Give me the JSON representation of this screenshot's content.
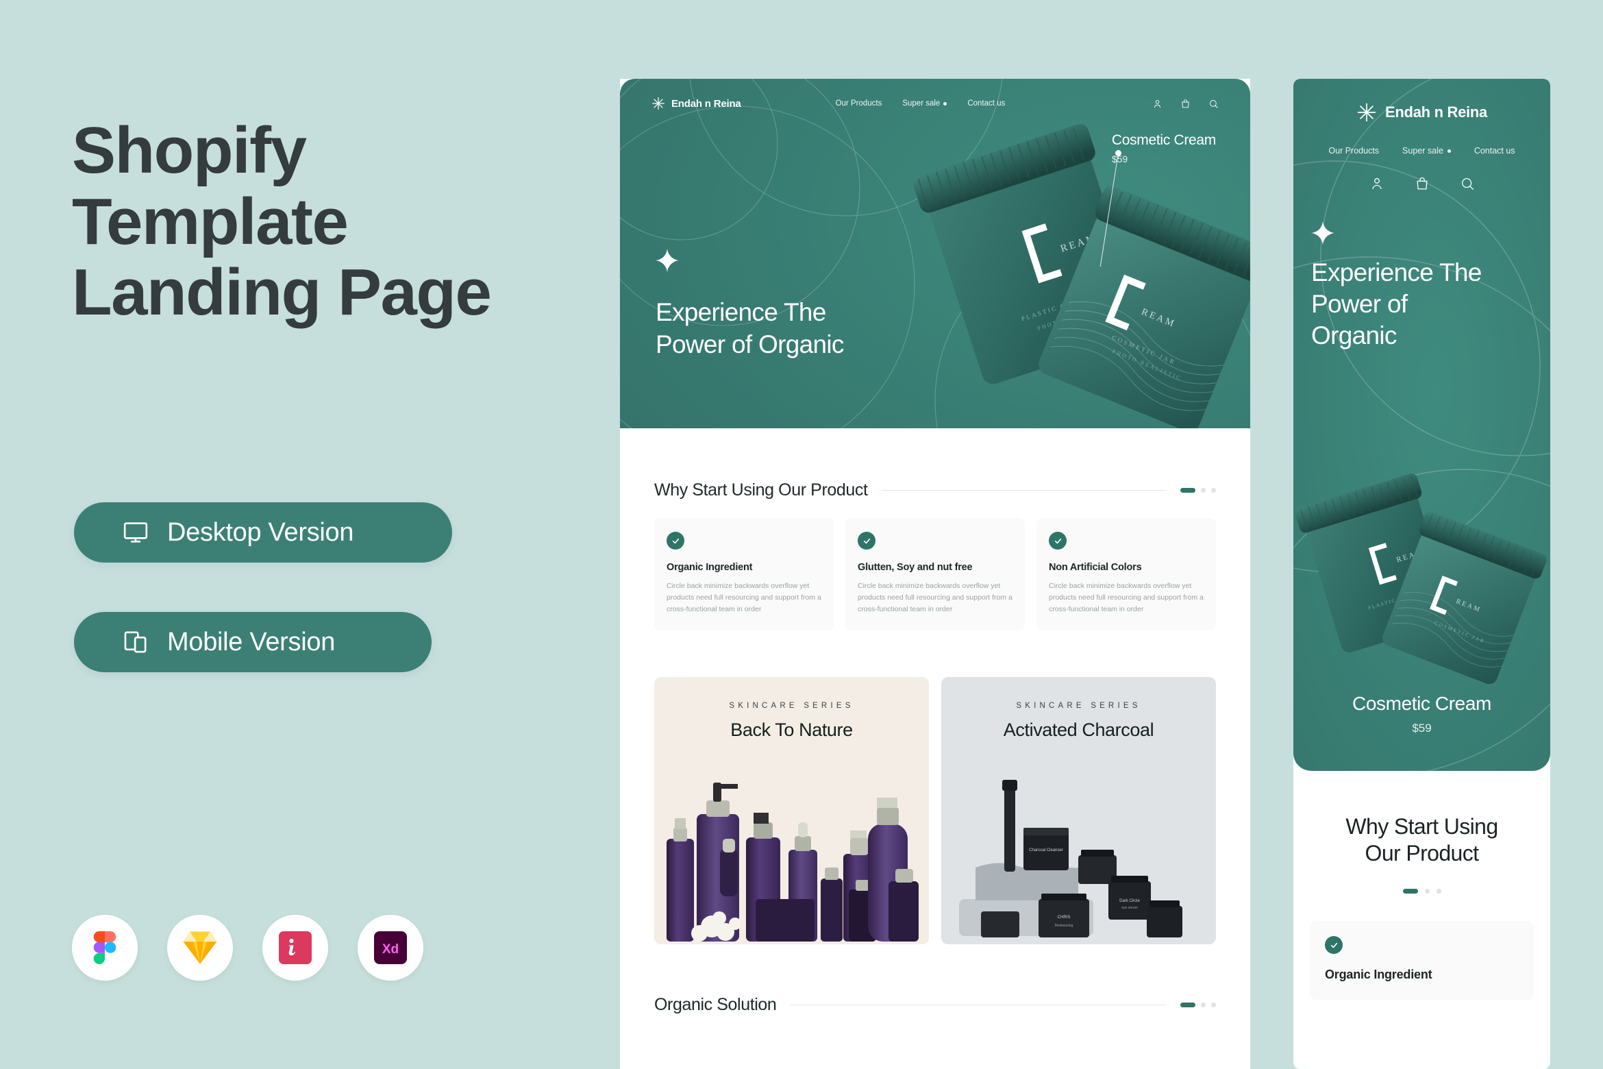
{
  "theme": {
    "page_bg": "#c6dfdc",
    "brand_teal": "#3c8075",
    "hero_teal": "#377a70",
    "heading_dark": "#343c3d",
    "card_bg": "#fafafa",
    "nature_bg": "#f4ede6",
    "charcoal_bg": "#dfe3e6"
  },
  "promo": {
    "line1": "Shopify",
    "line2": "Template",
    "line3": "Landing Page",
    "buttons": [
      {
        "label": "Desktop Version",
        "icon": "monitor-icon"
      },
      {
        "label": "Mobile Version",
        "icon": "devices-icon"
      }
    ],
    "apps": [
      {
        "name": "figma-icon",
        "label": "Figma"
      },
      {
        "name": "sketch-icon",
        "label": "Sketch"
      },
      {
        "name": "invision-icon",
        "label": "InVision"
      },
      {
        "name": "adobe-xd-icon",
        "label": "Adobe XD"
      }
    ]
  },
  "site": {
    "brand": "Endah n Reina",
    "nav": [
      {
        "label": "Our Products",
        "badge": false
      },
      {
        "label": "Super sale",
        "badge": true
      },
      {
        "label": "Contact us",
        "badge": false
      }
    ],
    "actions": [
      {
        "name": "account-icon"
      },
      {
        "name": "shopping-bag-icon"
      },
      {
        "name": "search-icon"
      }
    ],
    "hero": {
      "title_line1": "Experience The",
      "title_line2": "Power of Organic",
      "mobile_line1": "Experience The",
      "mobile_line2": "Power of",
      "mobile_line3": "Organic",
      "product_name": "Cosmetic Cream",
      "product_price": "$59"
    },
    "section_why": {
      "title": "Why Start Using Our Product",
      "mobile_title_line1": "Why Start Using",
      "mobile_title_line2": "Our Product",
      "pager": {
        "active": 1,
        "total": 3
      },
      "cards": [
        {
          "title": "Organic Ingredient",
          "body": "Circle back minimize backwards overflow yet products need full resourcing and support from a cross-functional team in order"
        },
        {
          "title": "Glutten, Soy and nut free",
          "body": "Circle back minimize backwards overflow yet products need full resourcing and support from a cross-functional team in order"
        },
        {
          "title": "Non Artificial Colors",
          "body": "Circle back minimize backwards overflow yet products need full resourcing and support from a cross-functional team in order"
        }
      ]
    },
    "series": [
      {
        "kicker": "SKINCARE SERIES",
        "title": "Back To Nature"
      },
      {
        "kicker": "SKINCARE SERIES",
        "title": "Activated Charcoal"
      }
    ],
    "section_solution": {
      "title": "Organic Solution",
      "pager": {
        "active": 1,
        "total": 3
      }
    }
  }
}
